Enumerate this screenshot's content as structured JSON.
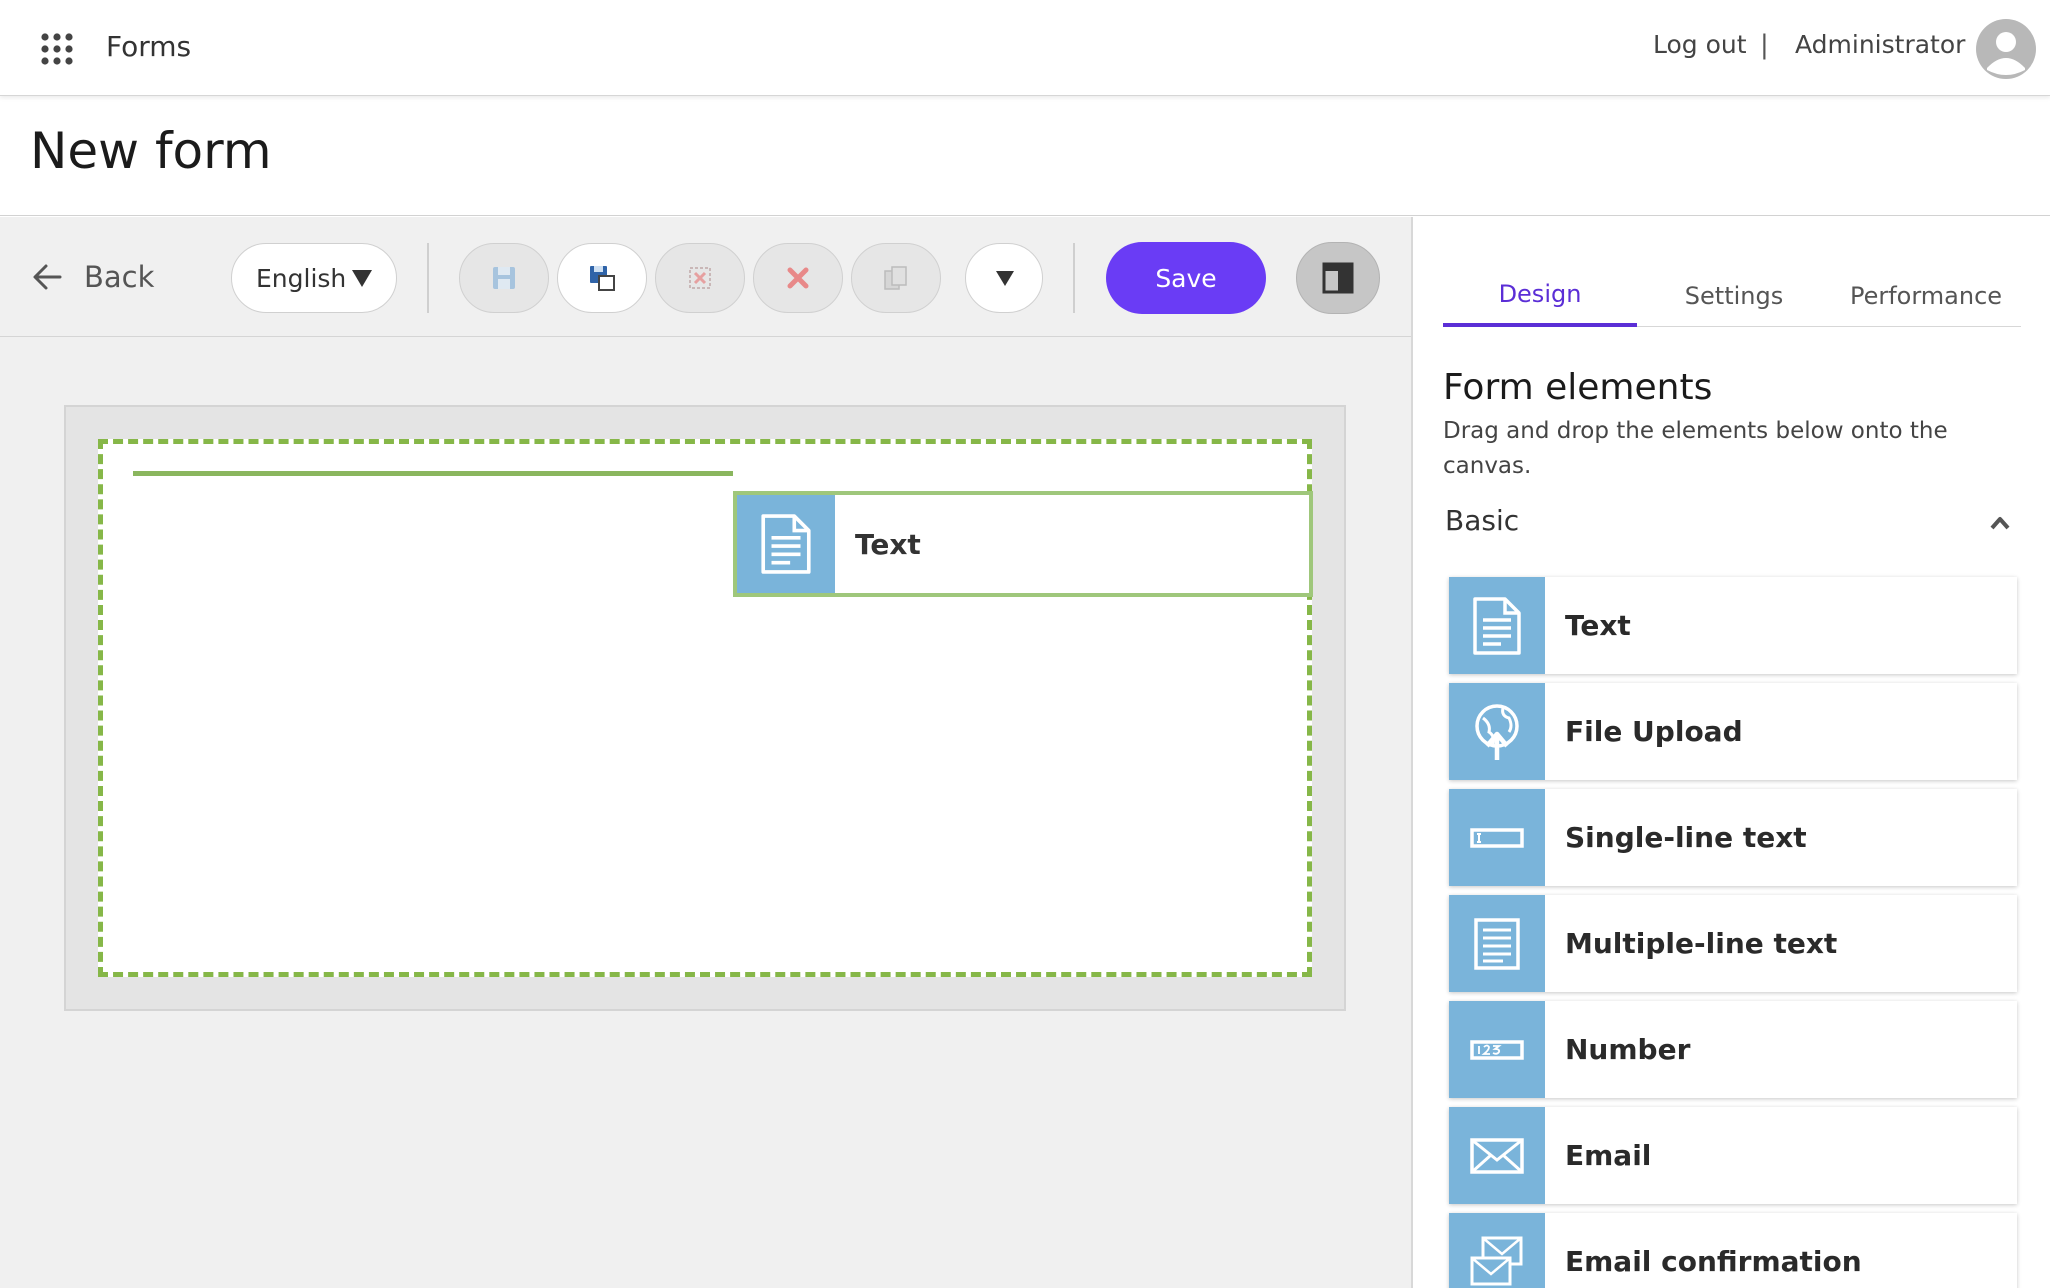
{
  "header": {
    "app_title": "Forms",
    "logout": "Log out",
    "separator": "|",
    "user": "Administrator"
  },
  "page": {
    "title": "New form"
  },
  "toolbar": {
    "back": "Back",
    "language": "English",
    "save": "Save",
    "tools": [
      {
        "icon": "save-disk-icon",
        "enabled": false
      },
      {
        "icon": "save-as-icon",
        "enabled": true
      },
      {
        "icon": "discard-icon",
        "enabled": false
      },
      {
        "icon": "delete-icon",
        "enabled": false
      },
      {
        "icon": "copy-icon",
        "enabled": false
      }
    ]
  },
  "canvas": {
    "dragging_item": {
      "label": "Text",
      "icon": "text-document-icon"
    }
  },
  "panel": {
    "tabs": [
      {
        "label": "Design",
        "active": true
      },
      {
        "label": "Settings",
        "active": false
      },
      {
        "label": "Performance",
        "active": false
      }
    ],
    "heading": "Form elements",
    "description": "Drag and drop the elements below onto the canvas.",
    "section": "Basic",
    "elements": [
      {
        "label": "Text",
        "icon": "text-document-icon"
      },
      {
        "label": "File Upload",
        "icon": "file-upload-icon"
      },
      {
        "label": "Single-line text",
        "icon": "single-line-text-icon"
      },
      {
        "label": "Multiple-line text",
        "icon": "multiple-line-text-icon"
      },
      {
        "label": "Number",
        "icon": "number-icon"
      },
      {
        "label": "Email",
        "icon": "email-icon"
      },
      {
        "label": "Email confirmation",
        "icon": "email-confirmation-icon"
      }
    ]
  },
  "colors": {
    "accent": "#6a3cf5",
    "tab_active": "#5b2ed6",
    "element_icon_bg": "#7ab4da",
    "drop_zone": "#86b748"
  }
}
